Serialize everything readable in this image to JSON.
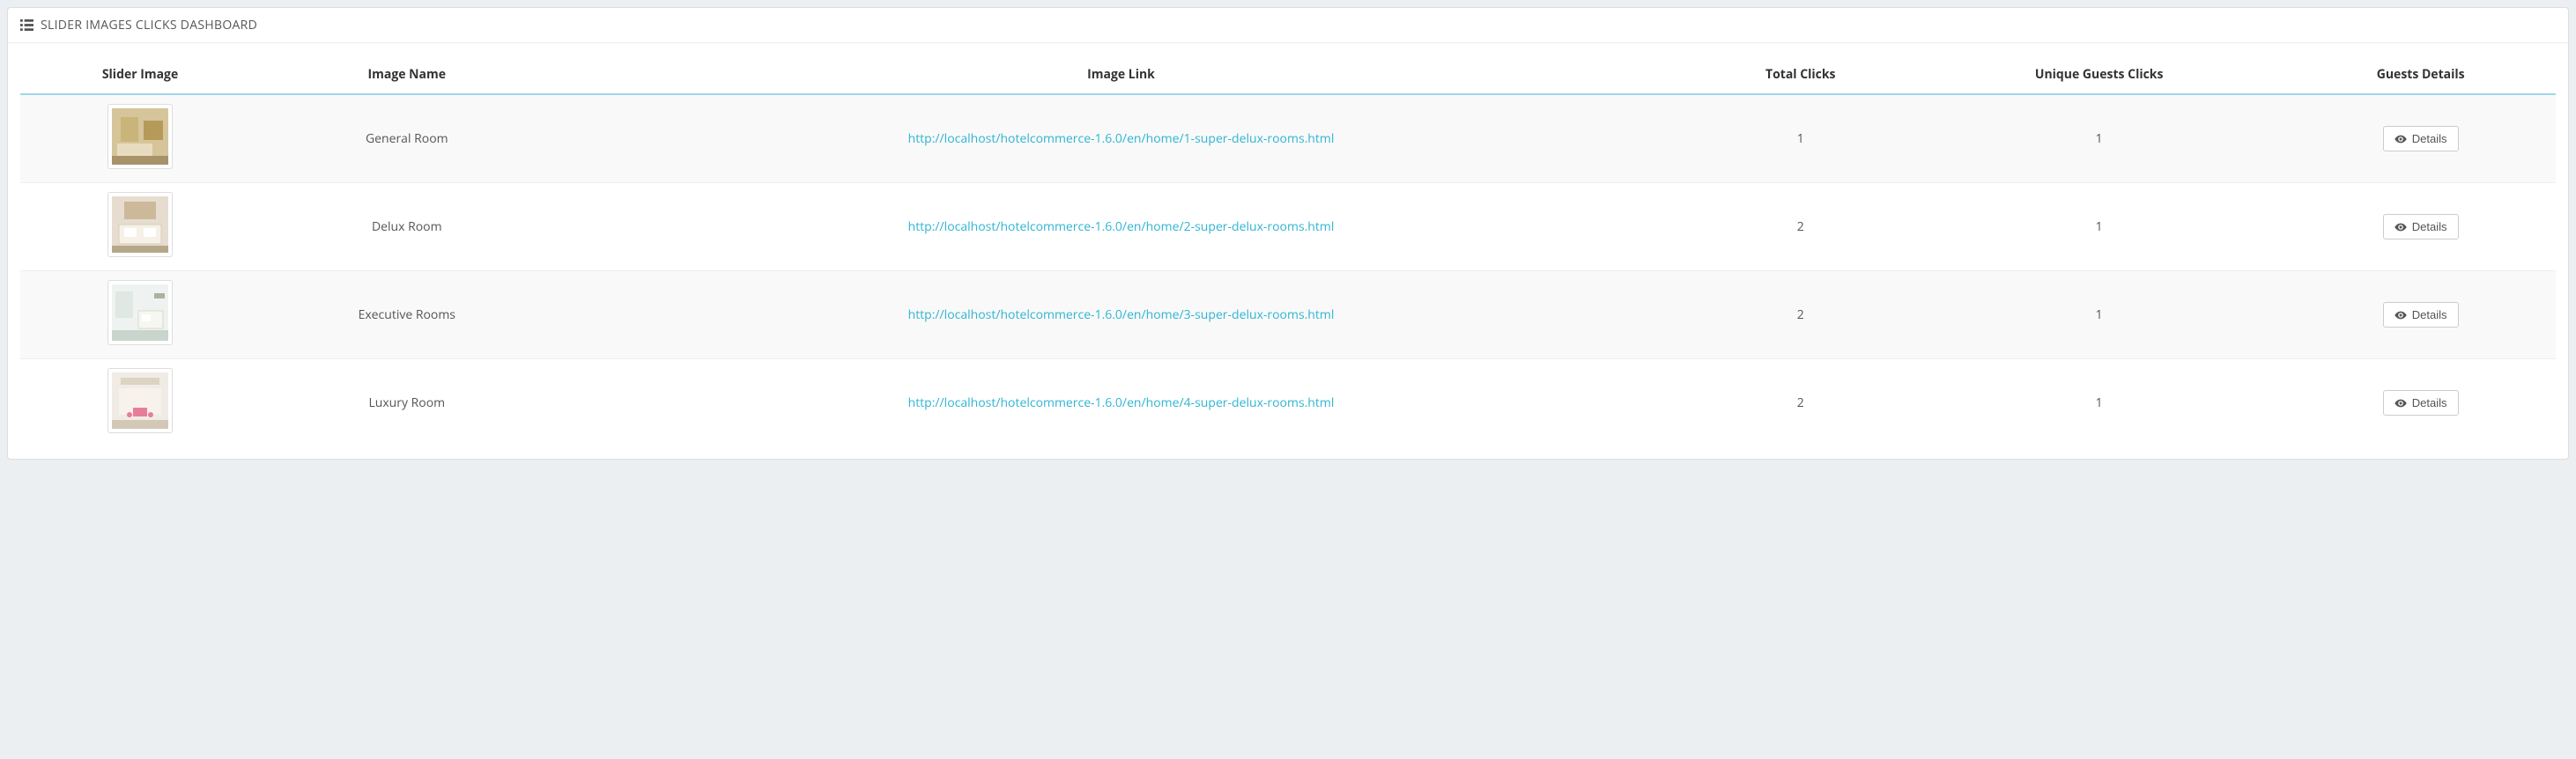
{
  "panel": {
    "title": "SLIDER IMAGES CLICKS DASHBOARD"
  },
  "table": {
    "headers": {
      "slider_image": "Slider Image",
      "image_name": "Image Name",
      "image_link": "Image Link",
      "total_clicks": "Total Clicks",
      "unique_guests_clicks": "Unique Guests Clicks",
      "guests_details": "Guests Details"
    },
    "details_label": "Details",
    "rows": [
      {
        "image_name": "General Room",
        "image_link": "http://localhost/hotelcommerce-1.6.0/en/home/1-super-delux-rooms.html",
        "total_clicks": "1",
        "unique_guests_clicks": "1"
      },
      {
        "image_name": "Delux Room",
        "image_link": "http://localhost/hotelcommerce-1.6.0/en/home/2-super-delux-rooms.html",
        "total_clicks": "2",
        "unique_guests_clicks": "1"
      },
      {
        "image_name": "Executive Rooms",
        "image_link": "http://localhost/hotelcommerce-1.6.0/en/home/3-super-delux-rooms.html",
        "total_clicks": "2",
        "unique_guests_clicks": "1"
      },
      {
        "image_name": "Luxury Room",
        "image_link": "http://localhost/hotelcommerce-1.6.0/en/home/4-super-delux-rooms.html",
        "total_clicks": "2",
        "unique_guests_clicks": "1"
      }
    ]
  }
}
